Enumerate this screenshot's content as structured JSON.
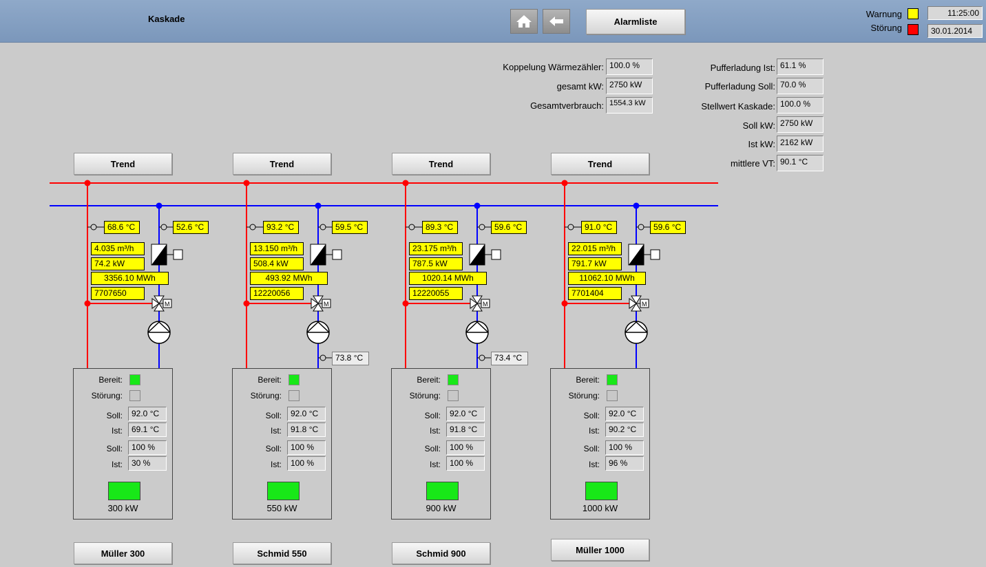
{
  "header": {
    "title": "Kaskade",
    "alarm_button": "Alarmliste",
    "legend_warning": "Warnung",
    "legend_fault": "Störung",
    "warning_color": "#ffff00",
    "fault_color": "#ff0000",
    "time": "11:25:00",
    "date": "30.01.2014"
  },
  "summary_left": [
    {
      "label": "Koppelung Wärmezähler:",
      "value": "100.0  %"
    },
    {
      "label": "gesamt kW:",
      "value": "2750  kW"
    },
    {
      "label": "Gesamtverbrauch:",
      "value": "1554.3  kW"
    }
  ],
  "summary_right": [
    {
      "label": "Pufferladung Ist:",
      "value": "61.1  %"
    },
    {
      "label": "Pufferladung Soll:",
      "value": "70.0  %"
    },
    {
      "label": "Stellwert Kaskade:",
      "value": "100.0  %"
    },
    {
      "label": "Soll kW:",
      "value": "2750  kW"
    },
    {
      "label": "Ist kW:",
      "value": "2162  kW"
    },
    {
      "label": "mittlere VT:",
      "value": "90.1  °C"
    }
  ],
  "colors": {
    "supply_line": "#ff0000",
    "return_line": "#0000ff",
    "ready": "#18e818"
  },
  "units": [
    {
      "trend": "Trend",
      "name": "Müller 300",
      "t_supply": "68.6  °C",
      "t_return": "52.6  °C",
      "flow": "4.035  m³/h",
      "power": "74.2  kW",
      "energy": "3356.10  MWh",
      "counter": "7707650",
      "t_boiler_return": "",
      "bereit_label": "Bereit:",
      "stoerung_label": "Störung:",
      "soll_label": "Soll:",
      "ist_label": "Ist:",
      "soll_temp": "92.0  °C",
      "ist_temp": "69.1  °C",
      "soll_pct": "100  %",
      "ist_pct": "30  %",
      "capacity": "300  kW",
      "motor": "M"
    },
    {
      "trend": "Trend",
      "name": "Schmid 550",
      "t_supply": "93.2  °C",
      "t_return": "59.5  °C",
      "flow": "13.150  m³/h",
      "power": "508.4  kW",
      "energy": "493.92  MWh",
      "counter": "12220056",
      "t_boiler_return": "73.8  °C",
      "bereit_label": "Bereit:",
      "stoerung_label": "Störung:",
      "soll_label": "Soll:",
      "ist_label": "Ist:",
      "soll_temp": "92.0  °C",
      "ist_temp": "91.8  °C",
      "soll_pct": "100  %",
      "ist_pct": "100  %",
      "capacity": "550  kW",
      "motor": "M"
    },
    {
      "trend": "Trend",
      "name": "Schmid 900",
      "t_supply": "89.3  °C",
      "t_return": "59.6  °C",
      "flow": "23.175  m³/h",
      "power": "787.5  kW",
      "energy": "1020.14  MWh",
      "counter": "12220055",
      "t_boiler_return": "73.4  °C",
      "bereit_label": "Bereit:",
      "stoerung_label": "Störung:",
      "soll_label": "Soll:",
      "ist_label": "Ist:",
      "soll_temp": "92.0  °C",
      "ist_temp": "91.8  °C",
      "soll_pct": "100  %",
      "ist_pct": "100  %",
      "capacity": "900  kW",
      "motor": "M"
    },
    {
      "trend": "Trend",
      "name": "Müller 1000",
      "t_supply": "91.0  °C",
      "t_return": "59.6  °C",
      "flow": "22.015  m³/h",
      "power": "791.7  kW",
      "energy": "11062.10  MWh",
      "counter": "7701404",
      "t_boiler_return": "",
      "bereit_label": "Bereit:",
      "stoerung_label": "Störung:",
      "soll_label": "Soll:",
      "ist_label": "Ist:",
      "soll_temp": "92.0  °C",
      "ist_temp": "90.2  °C",
      "soll_pct": "100  %",
      "ist_pct": "96  %",
      "capacity": "1000  kW",
      "motor": "M"
    }
  ]
}
